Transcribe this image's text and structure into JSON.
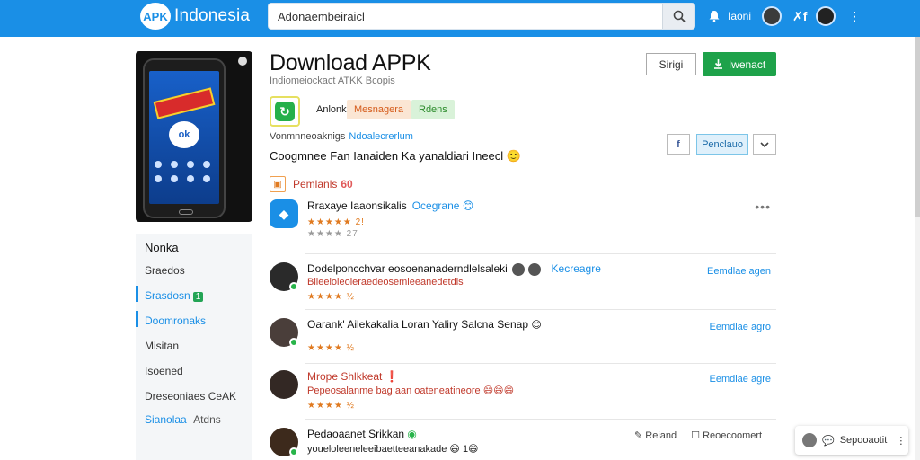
{
  "header": {
    "logo_badge": "APK",
    "logo_text": "Indonesia",
    "search_value": "Adonaembeiraicl",
    "user_label": "Iaoni",
    "icons": [
      "search-icon",
      "bell-icon",
      "avatar",
      "xf-icon",
      "more-vertical-icon"
    ]
  },
  "sidebar": {
    "heading": "Nonka",
    "items": [
      {
        "label": "Sraedos"
      },
      {
        "label": "Srasdosn",
        "badge": "1"
      },
      {
        "label": "Doomronaks"
      },
      {
        "label": "Misitan"
      },
      {
        "label": "Isoened"
      },
      {
        "label": "Dreseoniaes CeAK"
      },
      {
        "label": "Sianolaa",
        "suffix": "Atdns"
      }
    ]
  },
  "app": {
    "title": "Download APPK",
    "subtitle": "Indiomeiockact  ATKK Bcopis",
    "btn_outline": "Sirigi",
    "btn_download": "Iwenact",
    "tags": [
      "Anlonk",
      "Mesnagera",
      "Rdens"
    ],
    "meta_label": "Vonmnneoaknigs",
    "meta_link": "Ndoalecrerlum",
    "description": "Coogmnee Fan Ianaiden Ka yanaldiari Ineecl 🙂",
    "share_label": "Penclauo",
    "fb_label": "f"
  },
  "comments_section": {
    "label": "Pemlanls",
    "count": "60"
  },
  "comments": [
    {
      "name": "Rraxaye Iaaonsikalis",
      "tag": "Ocegrane 😊",
      "stars": "★★★★ 27",
      "rating_value": 4,
      "sub": "★★★★★ 2!"
    },
    {
      "name": "Dodelponcchvar eosoenanaderndlelsaleki",
      "tag": "Kecreagre",
      "sub": "Bileeioieoieraedeosemleeanedetdis",
      "stars": "★★★★ ½",
      "date": "Eemdlae agen"
    },
    {
      "name": "Oarank' Ailekakalia Loran Yaliry Salcna Senap",
      "emoji": "😊",
      "stars": "★★★★ ½",
      "date": "Eemdlae agro"
    },
    {
      "name": "Mrope Shlkkeat ❗",
      "sub": "Pepeosalanme bag aan oateneatineore 😄😄😄",
      "stars": "★★★★ ½",
      "date": "Eemdlae agre"
    },
    {
      "name": "Pedaoaanet Srikkan",
      "sub": "youeloleeneleeibaetteeanakade 😄 1😄",
      "stars": ""
    }
  ],
  "reply_actions": {
    "reload": "Reiand",
    "recommend": "Reoecoomert"
  },
  "support": {
    "label": "Sepooaotit"
  }
}
